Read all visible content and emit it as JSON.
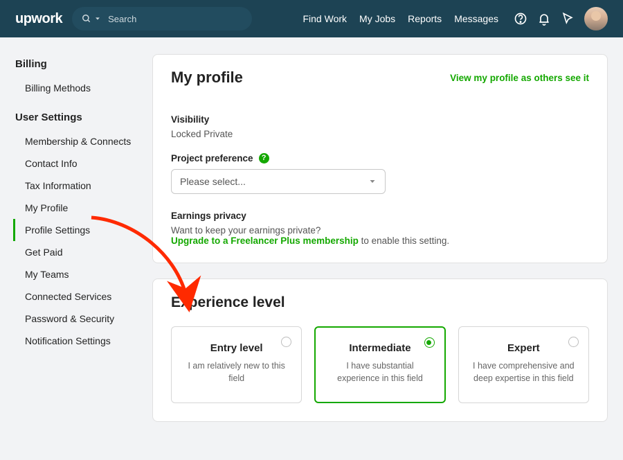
{
  "header": {
    "logo": "upwork",
    "search_placeholder": "Search",
    "nav": [
      "Find Work",
      "My Jobs",
      "Reports",
      "Messages"
    ]
  },
  "sidebar": {
    "groups": [
      {
        "heading": "Billing",
        "items": [
          {
            "label": "Billing Methods",
            "active": false
          }
        ]
      },
      {
        "heading": "User Settings",
        "items": [
          {
            "label": "Membership & Connects",
            "active": false
          },
          {
            "label": "Contact Info",
            "active": false
          },
          {
            "label": "Tax Information",
            "active": false
          },
          {
            "label": "My Profile",
            "active": false
          },
          {
            "label": "Profile Settings",
            "active": true
          },
          {
            "label": "Get Paid",
            "active": false
          },
          {
            "label": "My Teams",
            "active": false
          },
          {
            "label": "Connected Services",
            "active": false
          },
          {
            "label": "Password & Security",
            "active": false
          },
          {
            "label": "Notification Settings",
            "active": false
          }
        ]
      }
    ]
  },
  "profile_card": {
    "title": "My profile",
    "view_link": "View my profile as others see it",
    "visibility_label": "Visibility",
    "visibility_value": "Locked Private",
    "project_pref_label": "Project preference",
    "project_pref_placeholder": "Please select...",
    "earnings_label": "Earnings privacy",
    "earnings_question": "Want to keep your earnings private?",
    "earnings_link": "Upgrade to a Freelancer Plus membership",
    "earnings_suffix": " to enable this setting."
  },
  "experience_card": {
    "title": "Experience level",
    "options": [
      {
        "name": "Entry level",
        "desc": "I am relatively new to this field",
        "selected": false
      },
      {
        "name": "Intermediate",
        "desc": "I have substantial experience in this field",
        "selected": true
      },
      {
        "name": "Expert",
        "desc": "I have comprehensive and deep expertise in this field",
        "selected": false
      }
    ]
  }
}
